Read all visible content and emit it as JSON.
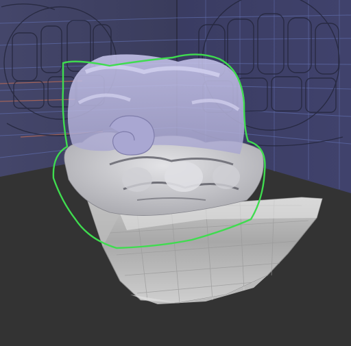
{
  "viewport": {
    "label": "",
    "background_color": "#353535",
    "left_wall_color": "#3f4160",
    "right_wall_color": "#3c3e66",
    "floor_color": "#323232",
    "mesh_color": "#c9c9cc",
    "mesh_shadow_color": "#8d8d94",
    "ghost_mesh_color": "#b7b5d8",
    "selection_outline_color": "#3fdc4f",
    "reference_line_color": "#5c6bb0",
    "reference_accent_color": "#b96a55"
  },
  "objects": [
    {
      "name": "selected-ghost-head-mesh",
      "state": "selected"
    },
    {
      "name": "jaw-box-mesh",
      "state": "unselected"
    }
  ]
}
